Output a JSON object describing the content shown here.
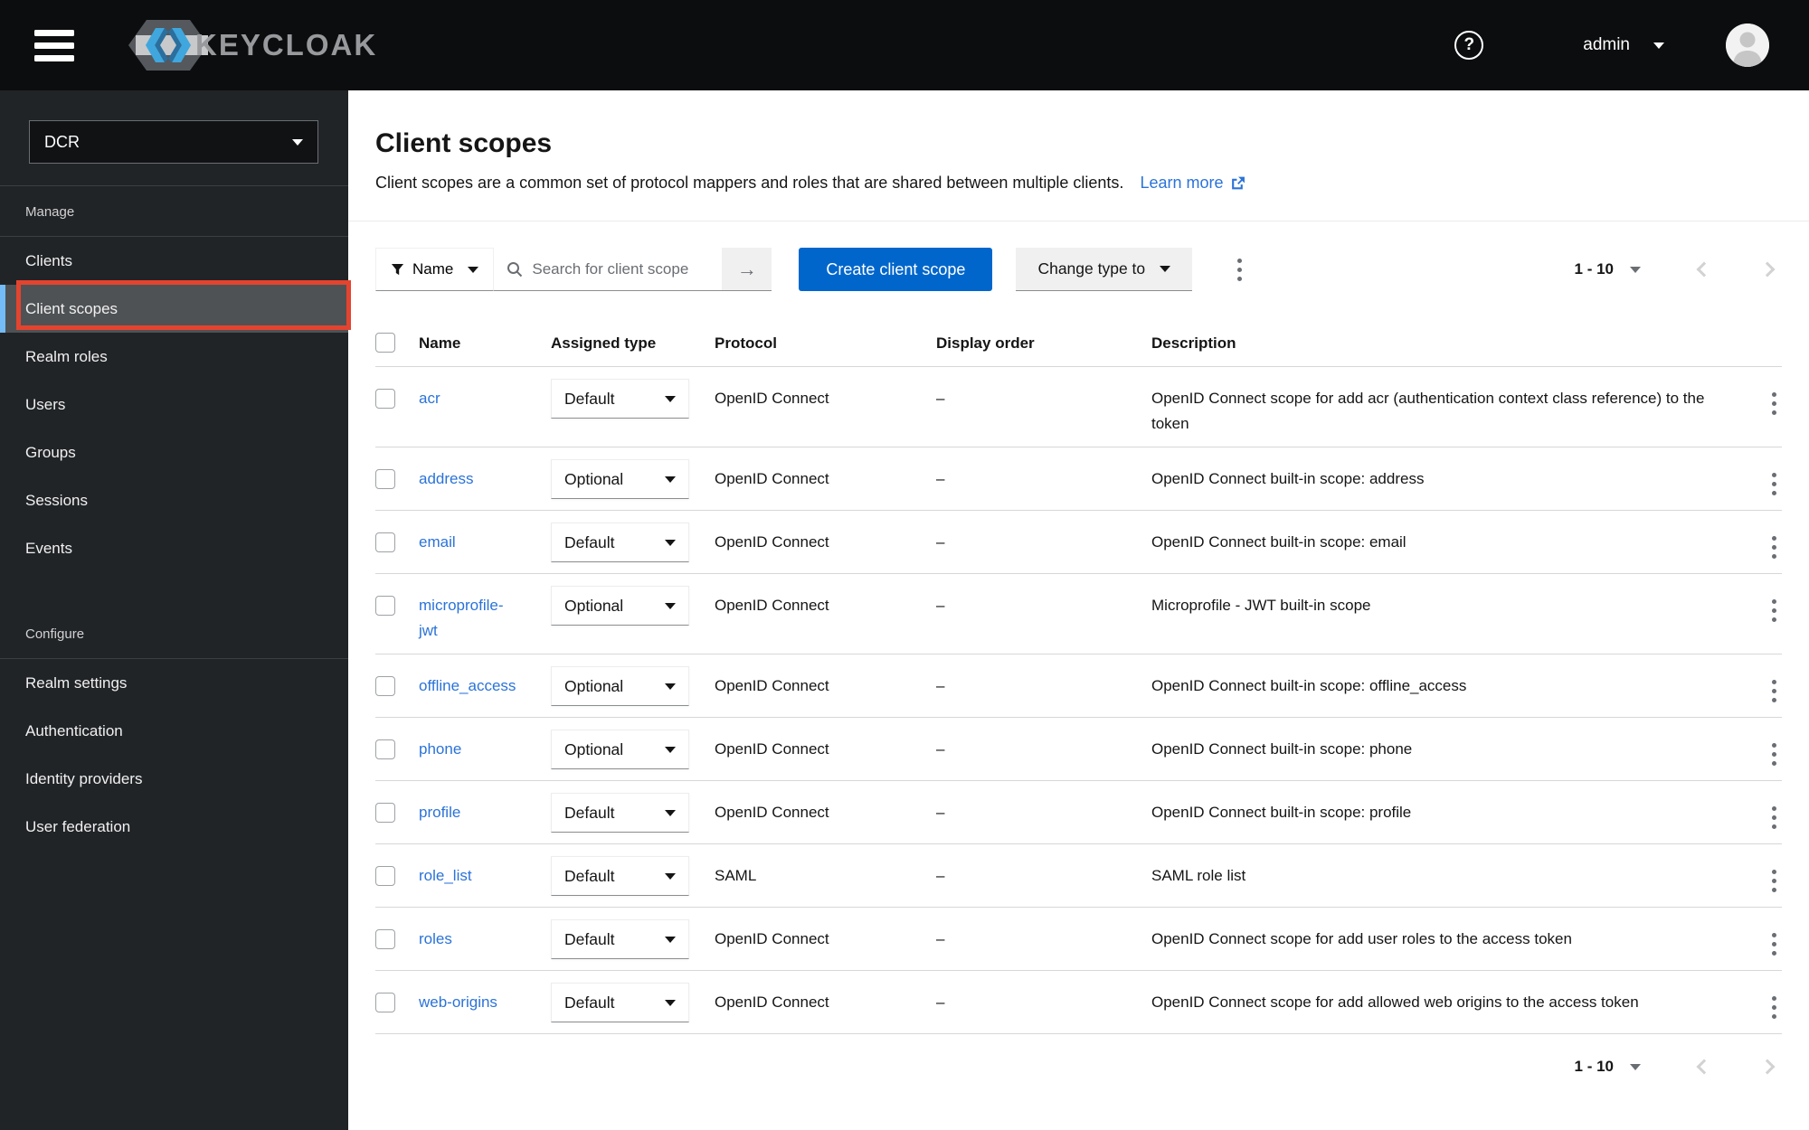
{
  "topbar": {
    "brand": "KEYCLOAK",
    "username": "admin"
  },
  "icons": {
    "question_mark": "?",
    "arrow_right": "→",
    "semantic": [
      "hamburger-menu-icon",
      "keycloak-logo",
      "help-icon",
      "chevron-down-icon",
      "avatar",
      "filter-funnel-icon",
      "search-icon",
      "arrow-right-icon",
      "kebab-icon",
      "chevron-left-icon",
      "chevron-right-icon",
      "external-link-icon",
      "checkbox"
    ]
  },
  "sidebar": {
    "realm": "DCR",
    "selected_item": "Client scopes",
    "sections": [
      {
        "label": "Manage",
        "items": [
          "Clients",
          "Client scopes",
          "Realm roles",
          "Users",
          "Groups",
          "Sessions",
          "Events"
        ]
      },
      {
        "label": "Configure",
        "items": [
          "Realm settings",
          "Authentication",
          "Identity providers",
          "User federation"
        ]
      }
    ]
  },
  "header": {
    "title": "Client scopes",
    "description": "Client scopes are a common set of protocol mappers and roles that are shared between multiple clients.",
    "learn_more": "Learn more"
  },
  "toolbar": {
    "filter_label": "Name",
    "search_placeholder": "Search for client scope",
    "create_button": "Create client scope",
    "change_type_button": "Change type to"
  },
  "pagination": {
    "label": "1 - 10"
  },
  "table": {
    "columns": [
      "Name",
      "Assigned type",
      "Protocol",
      "Display order",
      "Description"
    ],
    "rows": [
      {
        "name": "acr",
        "assigned_type": "Default",
        "protocol": "OpenID Connect",
        "display_order": "–",
        "description": "OpenID Connect scope for add acr (authentication context class reference) to the token"
      },
      {
        "name": "address",
        "assigned_type": "Optional",
        "protocol": "OpenID Connect",
        "display_order": "–",
        "description": "OpenID Connect built-in scope: address"
      },
      {
        "name": "email",
        "assigned_type": "Default",
        "protocol": "OpenID Connect",
        "display_order": "–",
        "description": "OpenID Connect built-in scope: email"
      },
      {
        "name": "microprofile-jwt",
        "assigned_type": "Optional",
        "protocol": "OpenID Connect",
        "display_order": "–",
        "description": "Microprofile - JWT built-in scope"
      },
      {
        "name": "offline_access",
        "assigned_type": "Optional",
        "protocol": "OpenID Connect",
        "display_order": "–",
        "description": "OpenID Connect built-in scope: offline_access"
      },
      {
        "name": "phone",
        "assigned_type": "Optional",
        "protocol": "OpenID Connect",
        "display_order": "–",
        "description": "OpenID Connect built-in scope: phone"
      },
      {
        "name": "profile",
        "assigned_type": "Default",
        "protocol": "OpenID Connect",
        "display_order": "–",
        "description": "OpenID Connect built-in scope: profile"
      },
      {
        "name": "role_list",
        "assigned_type": "Default",
        "protocol": "SAML",
        "display_order": "–",
        "description": "SAML role list"
      },
      {
        "name": "roles",
        "assigned_type": "Default",
        "protocol": "OpenID Connect",
        "display_order": "–",
        "description": "OpenID Connect scope for add user roles to the access token"
      },
      {
        "name": "web-origins",
        "assigned_type": "Default",
        "protocol": "OpenID Connect",
        "display_order": "–",
        "description": "OpenID Connect scope for add allowed web origins to the access token"
      }
    ]
  },
  "colors": {
    "topbar_bg": "#0c0d0e",
    "sidebar_bg": "#212427",
    "selected_item_bg": "#4f5255",
    "selected_indicator_blue": "#73bcf7",
    "annotation_red": "#e3442f",
    "primary_blue": "#0066cc",
    "link_blue": "#2b73d8",
    "row_border": "#d7d7d7"
  }
}
